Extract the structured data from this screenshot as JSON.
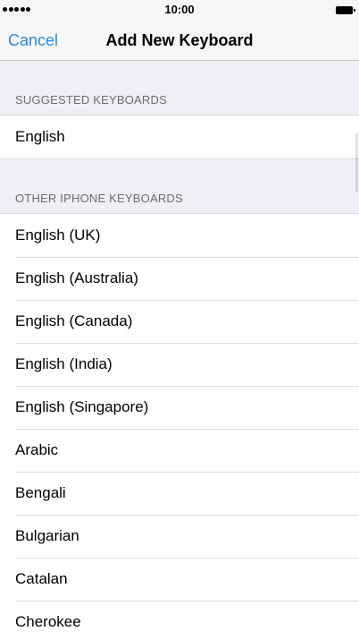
{
  "status_bar": {
    "time": "10:00",
    "signal_dots": 5
  },
  "nav": {
    "cancel_label": "Cancel",
    "title": "Add New Keyboard"
  },
  "sections": {
    "suggested": {
      "header": "SUGGESTED KEYBOARDS",
      "items": [
        "English"
      ]
    },
    "other": {
      "header": "OTHER IPHONE KEYBOARDS",
      "items": [
        "English (UK)",
        "English (Australia)",
        "English (Canada)",
        "English (India)",
        "English (Singapore)",
        "Arabic",
        "Bengali",
        "Bulgarian",
        "Catalan",
        "Cherokee"
      ]
    }
  },
  "colors": {
    "accent": "#2a8cd8",
    "background": "#efeff4",
    "section_header_text": "#6d6d72"
  }
}
